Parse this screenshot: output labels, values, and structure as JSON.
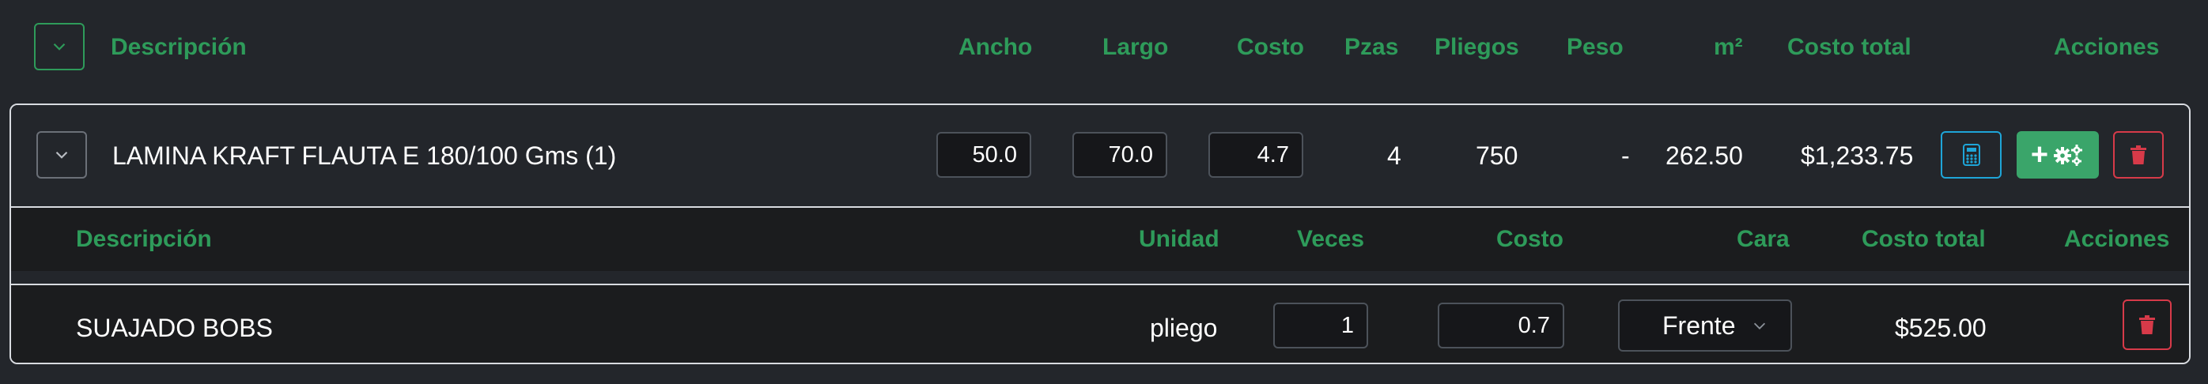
{
  "header": {
    "descripcion": "Descripción",
    "ancho": "Ancho",
    "largo": "Largo",
    "costo": "Costo",
    "pzas": "Pzas",
    "pliegos": "Pliegos",
    "peso": "Peso",
    "m2": "m²",
    "costo_total": "Costo total",
    "acciones": "Acciones"
  },
  "item": {
    "descripcion": "LAMINA KRAFT FLAUTA E 180/100 Gms (1)",
    "ancho": "50.0",
    "largo": "70.0",
    "costo": "4.7",
    "pzas": "4",
    "pliegos": "750",
    "peso": "-",
    "m2": "262.50",
    "costo_total": "$1,233.75",
    "add_button_label": "+"
  },
  "sub_header": {
    "descripcion": "Descripción",
    "unidad": "Unidad",
    "veces": "Veces",
    "costo": "Costo",
    "cara": "Cara",
    "costo_total": "Costo total",
    "acciones": "Acciones"
  },
  "process": {
    "descripcion": "SUAJADO BOBS",
    "unidad": "pliego",
    "veces": "1",
    "costo": "0.7",
    "cara": "Frente",
    "costo_total": "$525.00"
  },
  "colors": {
    "accent_green": "#2e9b5a",
    "info_blue": "#1ea5d8",
    "danger_red": "#d73a49",
    "success_bg": "#3aa56a"
  },
  "icons": {
    "collapse": "chevron-down-icon",
    "calculator": "calculator-icon",
    "gears": "gears-icon",
    "delete": "trash-icon"
  }
}
